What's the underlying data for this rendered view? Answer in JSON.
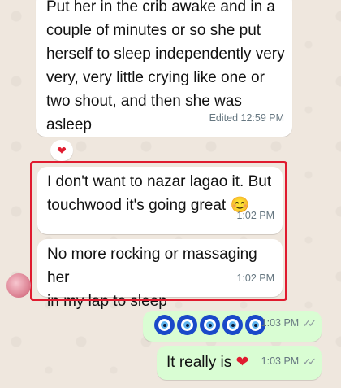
{
  "messages": [
    {
      "direction": "incoming",
      "text": "Put her in the crib awake and in a\ncouple of minutes or so she put\nherself to sleep independently very\nvery, very little crying like one or\ntwo shout, and then she was\nasleep",
      "meta": "Edited 12:59 PM",
      "reaction": "heart"
    },
    {
      "direction": "incoming",
      "text": "I don't want to nazar lagao it. But\ntouchwood it's going great",
      "emoji": "smiling-face",
      "time": "1:02 PM"
    },
    {
      "direction": "incoming",
      "text": "No more rocking or massaging her\nin my lap to sleep",
      "time": "1:02 PM"
    },
    {
      "direction": "outgoing",
      "emoji_count": 5,
      "emoji": "nazar-amulet",
      "time": "1:03 PM",
      "status": "read"
    },
    {
      "direction": "outgoing",
      "text": "It really is",
      "emoji": "heart",
      "time": "1:03 PM",
      "status": "read"
    }
  ],
  "highlight_color": "#e01b2f",
  "colors": {
    "incoming_bubble": "#ffffff",
    "outgoing_bubble": "#d9fdd3",
    "background": "#efe7de"
  }
}
